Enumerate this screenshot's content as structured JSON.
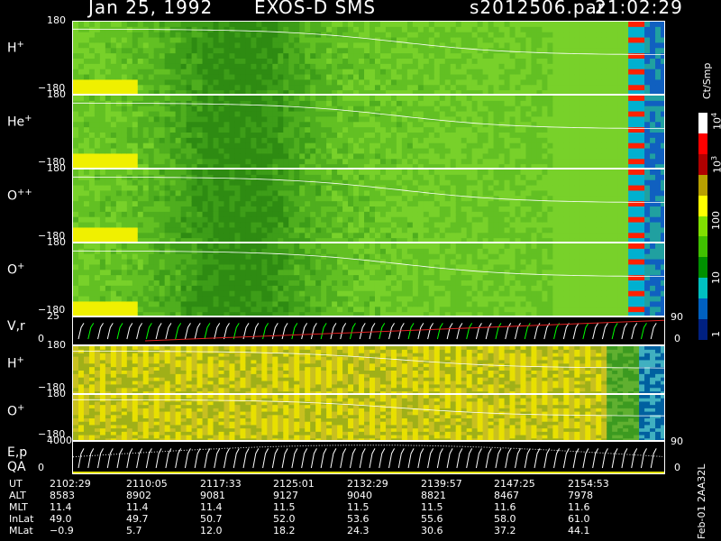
{
  "header": {
    "date": "Jan 25, 1992",
    "instrument": "EXOS-D SMS",
    "file": "s2012506.par",
    "time": "21:02:29"
  },
  "chart_data": [
    {
      "type": "heatmap",
      "label": "H+",
      "ytick_top": "180",
      "ytick_bottom": "-180",
      "colormap": "spectrogram"
    },
    {
      "type": "heatmap",
      "label": "He+",
      "ytick_top": "180",
      "ytick_bottom": "-180",
      "colormap": "spectrogram"
    },
    {
      "type": "heatmap",
      "label": "O++",
      "ytick_top": "180",
      "ytick_bottom": "-180",
      "colormap": "spectrogram"
    },
    {
      "type": "heatmap",
      "label": "O+",
      "ytick_top": "180",
      "ytick_bottom": "-180",
      "colormap": "spectrogram"
    },
    {
      "type": "line",
      "label": "V,r",
      "ytick_top": "25",
      "ytick_bottom": "0",
      "right_top": "90",
      "right_bottom": "0"
    },
    {
      "type": "heatmap",
      "label": "H+",
      "ytick_top": "180",
      "ytick_bottom": "-180",
      "colormap": "banded"
    },
    {
      "type": "heatmap",
      "label": "O+",
      "ytick_top": "180",
      "ytick_bottom": "-180",
      "colormap": "banded"
    },
    {
      "type": "line",
      "label": "E,p",
      "label2": "QA",
      "ytick_top": "4000",
      "ytick_bottom": "0",
      "right_top": "90",
      "right_bottom": "0"
    }
  ],
  "colorbar": {
    "title": "Ct/Smp",
    "ticks": [
      {
        "text": "10",
        "sup": "4"
      },
      {
        "text": "10",
        "sup": "3"
      },
      {
        "text": "100",
        "sup": ""
      },
      {
        "text": "10",
        "sup": ""
      },
      {
        "text": "1",
        "sup": ""
      }
    ],
    "colors": [
      "#ffffff",
      "#ff0000",
      "#b00000",
      "#b8a000",
      "#ffff00",
      "#80e000",
      "#40c000",
      "#009000",
      "#00c0c0",
      "#0060c0",
      "#002080"
    ]
  },
  "table": {
    "rows": [
      {
        "label": "UT",
        "values": [
          "2102:29",
          "2110:05",
          "2117:33",
          "2125:01",
          "2132:29",
          "2139:57",
          "2147:25",
          "2154:53"
        ]
      },
      {
        "label": "ALT",
        "values": [
          "8583",
          "8902",
          "9081",
          "9127",
          "9040",
          "8821",
          "8467",
          "7978"
        ]
      },
      {
        "label": "MLT",
        "values": [
          "11.4",
          "11.4",
          "11.4",
          "11.5",
          "11.5",
          "11.5",
          "11.6",
          "11.6"
        ]
      },
      {
        "label": "InLat",
        "values": [
          "49.0",
          "49.7",
          "50.7",
          "52.0",
          "53.6",
          "55.6",
          "58.0",
          "61.0"
        ]
      },
      {
        "label": "MLat",
        "values": [
          "-0.9",
          "5.7",
          "12.0",
          "18.2",
          "24.3",
          "30.6",
          "37.2",
          "44.1"
        ]
      }
    ]
  },
  "footer": "Feb-01 2AA32L"
}
